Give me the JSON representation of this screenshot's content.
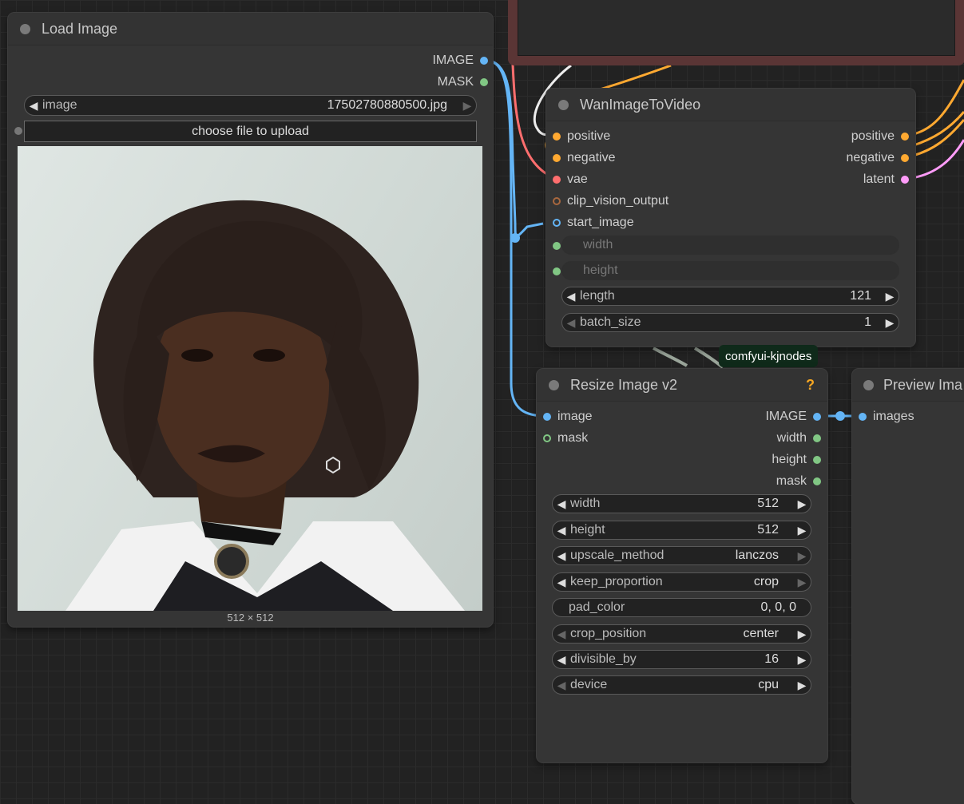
{
  "load_image": {
    "title": "Load Image",
    "outputs": [
      "IMAGE",
      "MASK"
    ],
    "image_widget": {
      "label": "image",
      "value": "17502780880500.jpg"
    },
    "upload_button": "choose file to upload",
    "preview_size": "512 × 512"
  },
  "wan": {
    "title": "WanImageToVideo",
    "inputs": [
      "positive",
      "negative",
      "vae",
      "clip_vision_output",
      "start_image"
    ],
    "outputs": [
      "positive",
      "negative",
      "latent"
    ],
    "width_label": "width",
    "height_label": "height",
    "length": {
      "label": "length",
      "value": "121"
    },
    "batch_size": {
      "label": "batch_size",
      "value": "1"
    }
  },
  "badge": "comfyui-kjnodes",
  "resize": {
    "title": "Resize Image v2",
    "help": "?",
    "inputs": [
      "image",
      "mask"
    ],
    "outputs": [
      "IMAGE",
      "width",
      "height",
      "mask"
    ],
    "widgets": [
      {
        "label": "width",
        "value": "512"
      },
      {
        "label": "height",
        "value": "512"
      },
      {
        "label": "upscale_method",
        "value": "lanczos"
      },
      {
        "label": "keep_proportion",
        "value": "crop"
      },
      {
        "label": "pad_color",
        "value": "0, 0, 0"
      },
      {
        "label": "crop_position",
        "value": "center"
      },
      {
        "label": "divisible_by",
        "value": "16"
      },
      {
        "label": "device",
        "value": "cpu"
      }
    ]
  },
  "preview": {
    "title": "Preview Ima",
    "inputs": [
      "images"
    ]
  },
  "colors": {
    "image": "#64b5f6",
    "mask": "#81c784",
    "int": "#81c784",
    "conditioning": "#ffa931",
    "vae": "#ff6e6e",
    "latent": "#ff9cf9",
    "clip_vision": "#a8673e"
  }
}
